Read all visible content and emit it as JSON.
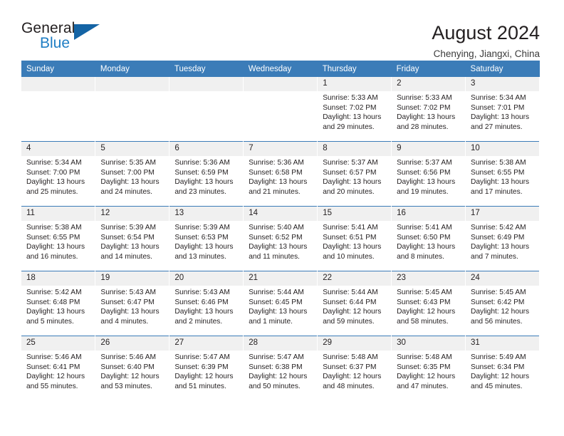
{
  "brand": {
    "name_line1": "General",
    "name_line2": "Blue",
    "triangle_color": "#1464a5",
    "blue_color": "#1f7ec4"
  },
  "header": {
    "title": "August 2024",
    "subtitle": "Chenying, Jiangxi, China",
    "accent_color": "#3b7cb8",
    "daynum_band_color": "#f0f0f0"
  },
  "weekday_headers": [
    "Sunday",
    "Monday",
    "Tuesday",
    "Wednesday",
    "Thursday",
    "Friday",
    "Saturday"
  ],
  "labels": {
    "sunrise_prefix": "Sunrise:",
    "sunset_prefix": "Sunset:",
    "daylight_prefix": "Daylight:"
  },
  "weeks": [
    [
      {
        "day": "",
        "empty": true
      },
      {
        "day": "",
        "empty": true
      },
      {
        "day": "",
        "empty": true
      },
      {
        "day": "",
        "empty": true
      },
      {
        "day": "1",
        "sunrise": "Sunrise: 5:33 AM",
        "sunset": "Sunset: 7:02 PM",
        "daylight": "Daylight: 13 hours and 29 minutes."
      },
      {
        "day": "2",
        "sunrise": "Sunrise: 5:33 AM",
        "sunset": "Sunset: 7:02 PM",
        "daylight": "Daylight: 13 hours and 28 minutes."
      },
      {
        "day": "3",
        "sunrise": "Sunrise: 5:34 AM",
        "sunset": "Sunset: 7:01 PM",
        "daylight": "Daylight: 13 hours and 27 minutes."
      }
    ],
    [
      {
        "day": "4",
        "sunrise": "Sunrise: 5:34 AM",
        "sunset": "Sunset: 7:00 PM",
        "daylight": "Daylight: 13 hours and 25 minutes."
      },
      {
        "day": "5",
        "sunrise": "Sunrise: 5:35 AM",
        "sunset": "Sunset: 7:00 PM",
        "daylight": "Daylight: 13 hours and 24 minutes."
      },
      {
        "day": "6",
        "sunrise": "Sunrise: 5:36 AM",
        "sunset": "Sunset: 6:59 PM",
        "daylight": "Daylight: 13 hours and 23 minutes."
      },
      {
        "day": "7",
        "sunrise": "Sunrise: 5:36 AM",
        "sunset": "Sunset: 6:58 PM",
        "daylight": "Daylight: 13 hours and 21 minutes."
      },
      {
        "day": "8",
        "sunrise": "Sunrise: 5:37 AM",
        "sunset": "Sunset: 6:57 PM",
        "daylight": "Daylight: 13 hours and 20 minutes."
      },
      {
        "day": "9",
        "sunrise": "Sunrise: 5:37 AM",
        "sunset": "Sunset: 6:56 PM",
        "daylight": "Daylight: 13 hours and 19 minutes."
      },
      {
        "day": "10",
        "sunrise": "Sunrise: 5:38 AM",
        "sunset": "Sunset: 6:55 PM",
        "daylight": "Daylight: 13 hours and 17 minutes."
      }
    ],
    [
      {
        "day": "11",
        "sunrise": "Sunrise: 5:38 AM",
        "sunset": "Sunset: 6:55 PM",
        "daylight": "Daylight: 13 hours and 16 minutes."
      },
      {
        "day": "12",
        "sunrise": "Sunrise: 5:39 AM",
        "sunset": "Sunset: 6:54 PM",
        "daylight": "Daylight: 13 hours and 14 minutes."
      },
      {
        "day": "13",
        "sunrise": "Sunrise: 5:39 AM",
        "sunset": "Sunset: 6:53 PM",
        "daylight": "Daylight: 13 hours and 13 minutes."
      },
      {
        "day": "14",
        "sunrise": "Sunrise: 5:40 AM",
        "sunset": "Sunset: 6:52 PM",
        "daylight": "Daylight: 13 hours and 11 minutes."
      },
      {
        "day": "15",
        "sunrise": "Sunrise: 5:41 AM",
        "sunset": "Sunset: 6:51 PM",
        "daylight": "Daylight: 13 hours and 10 minutes."
      },
      {
        "day": "16",
        "sunrise": "Sunrise: 5:41 AM",
        "sunset": "Sunset: 6:50 PM",
        "daylight": "Daylight: 13 hours and 8 minutes."
      },
      {
        "day": "17",
        "sunrise": "Sunrise: 5:42 AM",
        "sunset": "Sunset: 6:49 PM",
        "daylight": "Daylight: 13 hours and 7 minutes."
      }
    ],
    [
      {
        "day": "18",
        "sunrise": "Sunrise: 5:42 AM",
        "sunset": "Sunset: 6:48 PM",
        "daylight": "Daylight: 13 hours and 5 minutes."
      },
      {
        "day": "19",
        "sunrise": "Sunrise: 5:43 AM",
        "sunset": "Sunset: 6:47 PM",
        "daylight": "Daylight: 13 hours and 4 minutes."
      },
      {
        "day": "20",
        "sunrise": "Sunrise: 5:43 AM",
        "sunset": "Sunset: 6:46 PM",
        "daylight": "Daylight: 13 hours and 2 minutes."
      },
      {
        "day": "21",
        "sunrise": "Sunrise: 5:44 AM",
        "sunset": "Sunset: 6:45 PM",
        "daylight": "Daylight: 13 hours and 1 minute."
      },
      {
        "day": "22",
        "sunrise": "Sunrise: 5:44 AM",
        "sunset": "Sunset: 6:44 PM",
        "daylight": "Daylight: 12 hours and 59 minutes."
      },
      {
        "day": "23",
        "sunrise": "Sunrise: 5:45 AM",
        "sunset": "Sunset: 6:43 PM",
        "daylight": "Daylight: 12 hours and 58 minutes."
      },
      {
        "day": "24",
        "sunrise": "Sunrise: 5:45 AM",
        "sunset": "Sunset: 6:42 PM",
        "daylight": "Daylight: 12 hours and 56 minutes."
      }
    ],
    [
      {
        "day": "25",
        "sunrise": "Sunrise: 5:46 AM",
        "sunset": "Sunset: 6:41 PM",
        "daylight": "Daylight: 12 hours and 55 minutes."
      },
      {
        "day": "26",
        "sunrise": "Sunrise: 5:46 AM",
        "sunset": "Sunset: 6:40 PM",
        "daylight": "Daylight: 12 hours and 53 minutes."
      },
      {
        "day": "27",
        "sunrise": "Sunrise: 5:47 AM",
        "sunset": "Sunset: 6:39 PM",
        "daylight": "Daylight: 12 hours and 51 minutes."
      },
      {
        "day": "28",
        "sunrise": "Sunrise: 5:47 AM",
        "sunset": "Sunset: 6:38 PM",
        "daylight": "Daylight: 12 hours and 50 minutes."
      },
      {
        "day": "29",
        "sunrise": "Sunrise: 5:48 AM",
        "sunset": "Sunset: 6:37 PM",
        "daylight": "Daylight: 12 hours and 48 minutes."
      },
      {
        "day": "30",
        "sunrise": "Sunrise: 5:48 AM",
        "sunset": "Sunset: 6:35 PM",
        "daylight": "Daylight: 12 hours and 47 minutes."
      },
      {
        "day": "31",
        "sunrise": "Sunrise: 5:49 AM",
        "sunset": "Sunset: 6:34 PM",
        "daylight": "Daylight: 12 hours and 45 minutes."
      }
    ]
  ]
}
